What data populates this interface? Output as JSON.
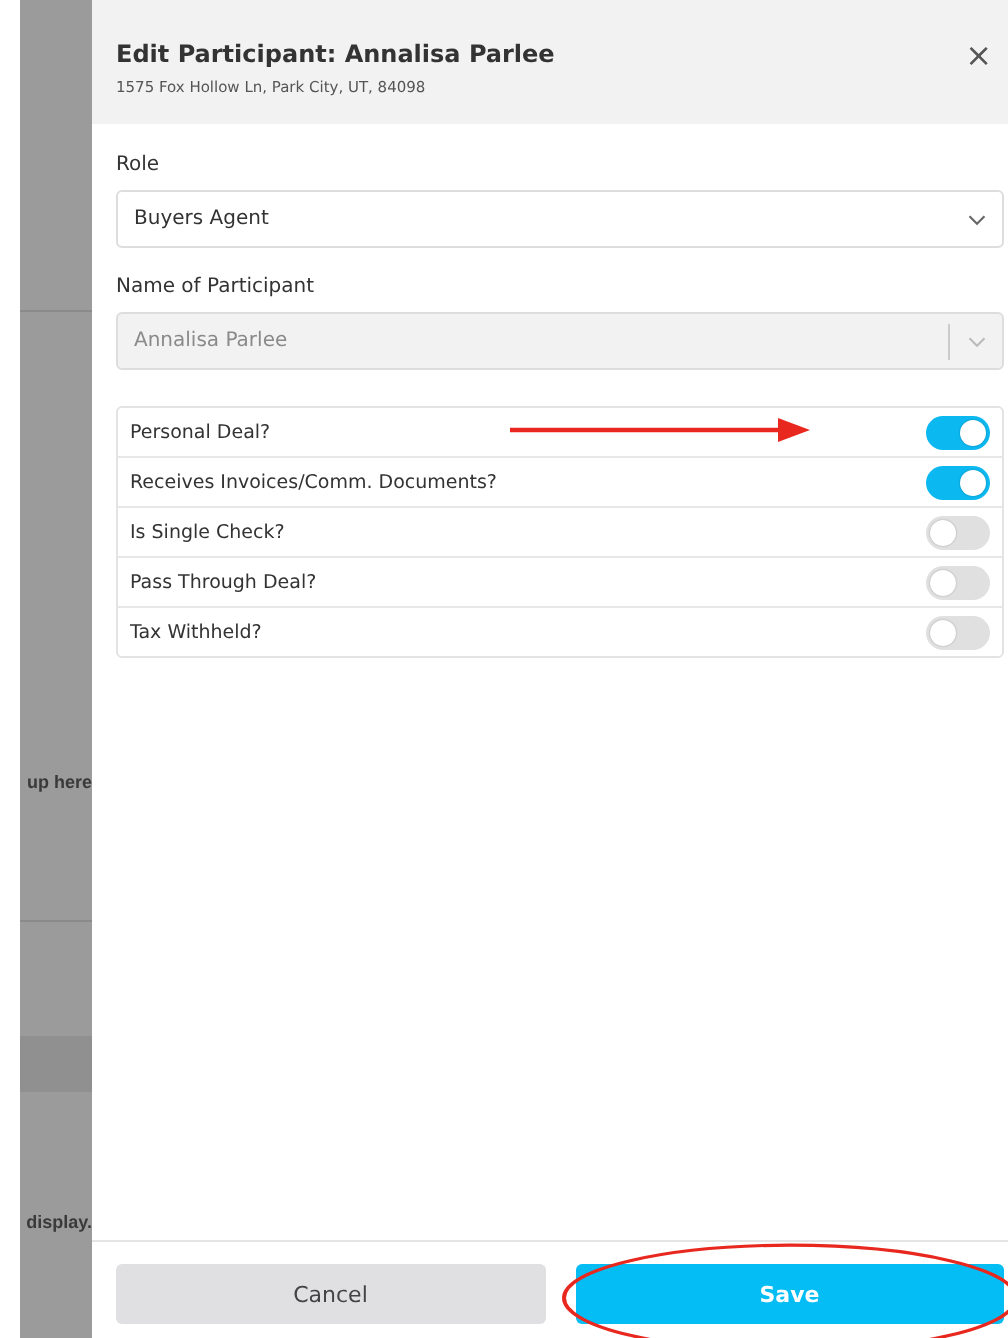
{
  "background": {
    "texts": [
      "up here",
      "display."
    ]
  },
  "dialog": {
    "title": "Edit Participant: Annalisa Parlee",
    "subtitle": "1575 Fox Hollow Ln, Park City, UT, 84098",
    "close": "×",
    "fields": [
      {
        "label": "Role",
        "value": "Buyers Agent",
        "disabled": false
      },
      {
        "label": "Name of Participant",
        "value": "Annalisa Parlee",
        "disabled": true
      }
    ],
    "toggles": [
      {
        "label": "Personal Deal?",
        "on": true
      },
      {
        "label": "Receives Invoices/Comm. Documents?",
        "on": true
      },
      {
        "label": "Is Single Check?",
        "on": false
      },
      {
        "label": "Pass Through Deal?",
        "on": false
      },
      {
        "label": "Tax Withheld?",
        "on": false
      }
    ],
    "buttons": [
      {
        "label": "Cancel",
        "kind": "secondary"
      },
      {
        "label": "Save",
        "kind": "primary"
      }
    ]
  }
}
